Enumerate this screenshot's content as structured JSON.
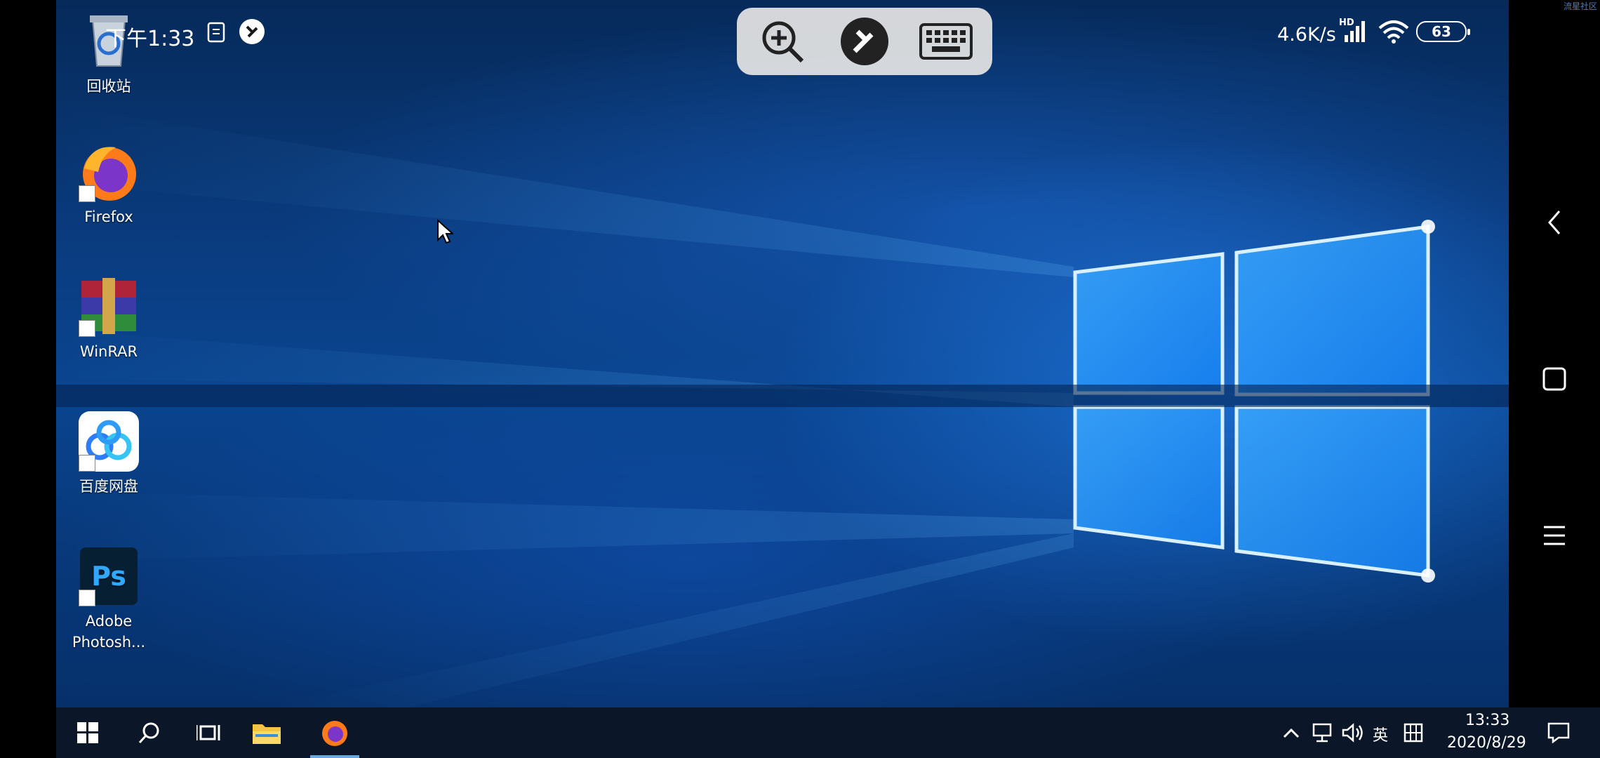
{
  "status_bar": {
    "time": "下午1:33",
    "net_speed": "4.6K/s",
    "signal_label": "HD",
    "battery": "63"
  },
  "watermark": "流星社区",
  "remote_toolbar": {
    "zoom": "zoom-in-icon",
    "remote": "remote-desktop-icon",
    "keyboard": "keyboard-icon"
  },
  "desktop": {
    "icons": [
      {
        "label": "回收站",
        "icon": "recycle-bin-icon"
      },
      {
        "label": "Firefox",
        "icon": "firefox-icon"
      },
      {
        "label": "WinRAR",
        "icon": "winrar-icon"
      },
      {
        "label": "百度网盘",
        "icon": "baidu-netdisk-icon"
      },
      {
        "label": "Adobe\nPhotosh...",
        "label_line1": "Adobe",
        "label_line2": "Photosh...",
        "icon": "photoshop-icon"
      }
    ]
  },
  "taskbar": {
    "tray": {
      "ime": "英",
      "clock_time": "13:33",
      "clock_date": "2020/8/29"
    }
  },
  "colors": {
    "taskbar_bg": "#0b1629",
    "wallpaper_accent": "#2a9cff",
    "toolbar_bg": "#e1e1e1"
  }
}
